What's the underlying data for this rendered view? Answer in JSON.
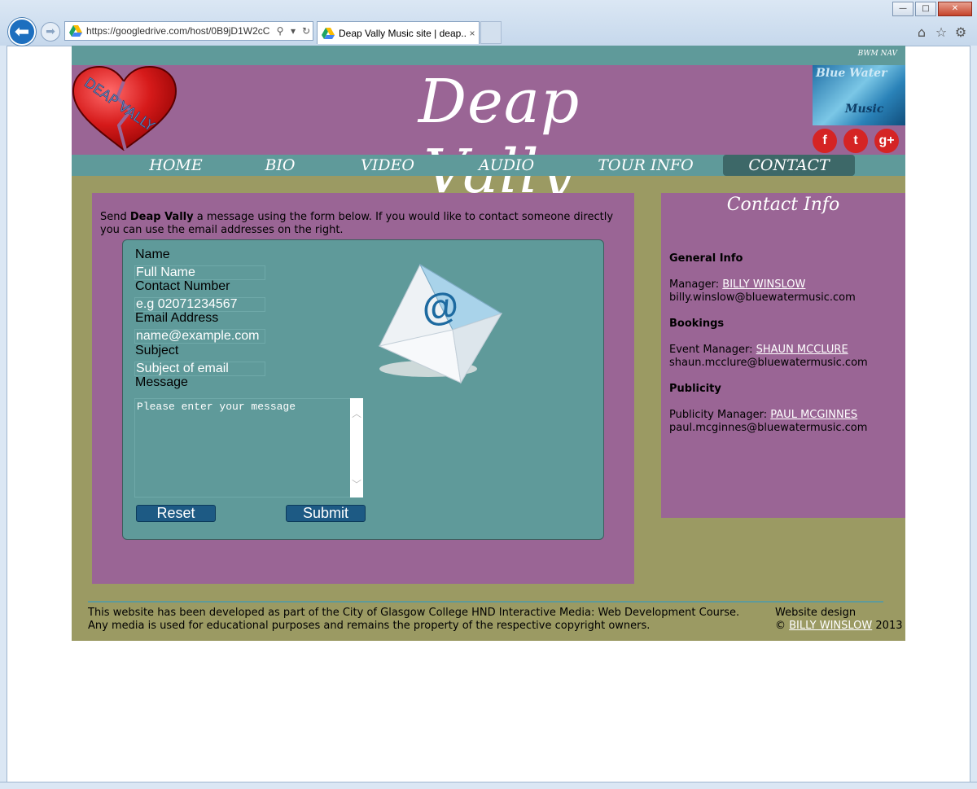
{
  "browser": {
    "url": "https://googledrive.com/host/0B9jD1W2cC",
    "tab_title": "Deap Vally Music site | deap...",
    "tab_close": "×"
  },
  "site": {
    "topbar_label": "BWM NAV",
    "title": "Deap Vally",
    "heart_text": "DEAP VALLY",
    "logo_line1": "Blue Water",
    "logo_line2": "Music",
    "social": [
      {
        "name": "facebook-icon",
        "glyph": "f"
      },
      {
        "name": "twitter-icon",
        "glyph": "t"
      },
      {
        "name": "google-plus-icon",
        "glyph": "g+"
      }
    ],
    "nav": [
      {
        "label": "HOME"
      },
      {
        "label": "BIO"
      },
      {
        "label": "VIDEO"
      },
      {
        "label": "AUDIO"
      },
      {
        "label": "TOUR INFO"
      },
      {
        "label": "CONTACT"
      }
    ]
  },
  "intro": {
    "pre": "Send ",
    "bold": "Deap Vally",
    "post": " a message using the form below. If you would like to contact someone directly you can use the email addresses on the right."
  },
  "form": {
    "name_label": "Name",
    "name_placeholder": "Full Name",
    "phone_label": "Contact Number",
    "phone_placeholder": "e.g 02071234567",
    "email_label": "Email Address",
    "email_placeholder": "name@example.com",
    "subject_label": "Subject",
    "subject_placeholder": "Subject of email",
    "message_label": "Message",
    "message_placeholder": "Please enter your message",
    "reset": "Reset",
    "submit": "Submit"
  },
  "contact": {
    "title": "Contact Info",
    "general_heading": "General Info",
    "manager_role": "Manager: ",
    "manager_name": "BILLY WINSLOW",
    "manager_email": "billy.winslow@bluewatermusic.com",
    "bookings_heading": "Bookings",
    "event_role": "Event Manager: ",
    "event_name": "SHAUN MCCLURE",
    "event_email": "shaun.mcclure@bluewatermusic.com",
    "publicity_heading": "Publicity",
    "publicity_role": "Publicity Manager: ",
    "publicity_name": "PAUL MCGINNES",
    "publicity_email": "paul.mcginnes@bluewatermusic.com"
  },
  "footer": {
    "line1": "This website has been developed as part of the City of Glasgow College HND Interactive Media: Web Development Course.",
    "line2": "Any media is used for educational purposes and remains the property of the respective copyright owners.",
    "design_label": "Website design",
    "copyright": "© ",
    "author": "BILLY WINSLOW",
    "year": " 2013"
  }
}
